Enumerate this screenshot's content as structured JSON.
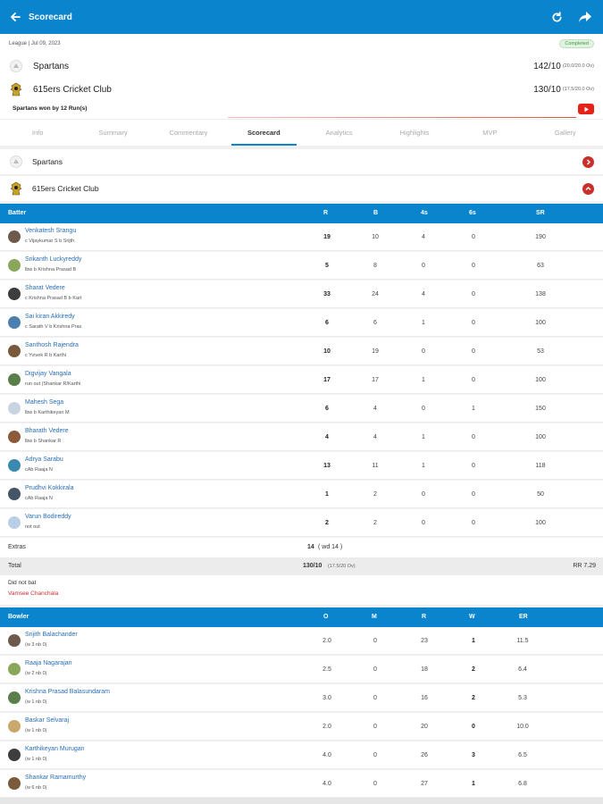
{
  "appbar": {
    "title": "Scorecard"
  },
  "match": {
    "meta": "League | Jul 09, 2023",
    "status": "Completed",
    "team1": {
      "name": "Spartans",
      "score": "142/10",
      "overs": "(20.0/20.0 Ov)"
    },
    "team2": {
      "name": "615ers Cricket Club",
      "score": "130/10",
      "overs": "(17.5/20.0 Ov)"
    },
    "result": "Spartans won by 12 Run(s)"
  },
  "tabs": [
    "Info",
    "Summary",
    "Commentary",
    "Scorecard",
    "Analytics",
    "Highlights",
    "MVP",
    "Gallery"
  ],
  "innings_tiles": [
    {
      "name": "Spartans"
    },
    {
      "name": "615ers Cricket Club"
    }
  ],
  "batting": {
    "headers": {
      "player": "Batter",
      "r": "R",
      "b": "B",
      "fours": "4s",
      "sixes": "6s",
      "sr": "SR"
    },
    "rows": [
      {
        "name": "Venkatesh Srangu",
        "dismissal": "c Vijaykumar S b Srijth",
        "r": "19",
        "b": "10",
        "fours": "4",
        "sixes": "0",
        "sr": "190"
      },
      {
        "name": "Srikanth Luckyreddy",
        "dismissal": "lbw b Krishna Prasad B",
        "r": "5",
        "b": "8",
        "fours": "0",
        "sixes": "0",
        "sr": "63"
      },
      {
        "name": "Sharat Vedere",
        "dismissal": "c Krishna Prasad B b Kart",
        "r": "33",
        "b": "24",
        "fours": "4",
        "sixes": "0",
        "sr": "138"
      },
      {
        "name": "Sai kiran Akkiredy",
        "dismissal": "c Sarath V b Krishna Pras",
        "r": "6",
        "b": "6",
        "fours": "1",
        "sixes": "0",
        "sr": "100"
      },
      {
        "name": "Santhosh Rajendra",
        "dismissal": "c Yvivek R b Karthi",
        "r": "10",
        "b": "19",
        "fours": "0",
        "sixes": "0",
        "sr": "53"
      },
      {
        "name": "Digvijay Vangala",
        "dismissal": "run out (Shankar R/Karthi",
        "r": "17",
        "b": "17",
        "fours": "1",
        "sixes": "0",
        "sr": "100"
      },
      {
        "name": "Mahesh Sega",
        "dismissal": "lbw b Karthikeyan M",
        "r": "6",
        "b": "4",
        "fours": "0",
        "sixes": "1",
        "sr": "150"
      },
      {
        "name": "Bharath Vedere",
        "dismissal": "lbw b Shankar R",
        "r": "4",
        "b": "4",
        "fours": "1",
        "sixes": "0",
        "sr": "100"
      },
      {
        "name": "Adrya Sarabu",
        "dismissal": "cAb Raaja N",
        "r": "13",
        "b": "11",
        "fours": "1",
        "sixes": "0",
        "sr": "118"
      },
      {
        "name": "Prudhvi Kokkirala",
        "dismissal": "cAb Raaja N",
        "r": "1",
        "b": "2",
        "fours": "0",
        "sixes": "0",
        "sr": "50"
      },
      {
        "name": "Varun Bodireddy",
        "dismissal": "not out",
        "r": "2",
        "b": "2",
        "fours": "0",
        "sixes": "0",
        "sr": "100"
      }
    ],
    "extras_label": "Extras",
    "extras_value": "14",
    "extras_detail": "( wd 14 )",
    "total_label": "Total",
    "total_value": "130/10",
    "total_overs": "(17.5/20 Ov)",
    "run_rate": "RR 7.29",
    "dnb_label": "Did not bat",
    "dnb_players": "Vamsee Chanchala"
  },
  "bowling": {
    "headers": {
      "player": "Bowler",
      "o": "O",
      "m": "M",
      "r": "R",
      "w": "W",
      "er": "ER"
    },
    "rows": [
      {
        "name": "Srijith Balachander",
        "extras": "(w 3 nb 0)",
        "o": "2.0",
        "m": "0",
        "r": "23",
        "w": "1",
        "er": "11.5"
      },
      {
        "name": "Raaja Nagarajan",
        "extras": "(w 2 nb 0)",
        "o": "2.5",
        "m": "0",
        "r": "18",
        "w": "2",
        "er": "6.4"
      },
      {
        "name": "Krishna Prasad Balasundaram",
        "extras": "(w 1 nb 0)",
        "o": "3.0",
        "m": "0",
        "r": "16",
        "w": "2",
        "er": "5.3"
      },
      {
        "name": "Baskar Selvaraj",
        "extras": "(w 1 nb 0)",
        "o": "2.0",
        "m": "0",
        "r": "20",
        "w": "0",
        "er": "10.0"
      },
      {
        "name": "Karthikeyan Murugan",
        "extras": "(w 1 nb 0)",
        "o": "4.0",
        "m": "0",
        "r": "26",
        "w": "3",
        "er": "6.5"
      },
      {
        "name": "Shankar Ramamurthy",
        "extras": "(w 6 nb 0)",
        "o": "4.0",
        "m": "0",
        "r": "27",
        "w": "1",
        "er": "6.8"
      }
    ]
  },
  "colors": {
    "primary": "#0a84cd",
    "danger": "#c9302c",
    "link": "#2a6fb5",
    "youtube": "#e62117"
  },
  "icons": [
    "back-arrow-icon",
    "refresh-icon",
    "share-icon",
    "youtube-icon",
    "chevron-right-icon",
    "chevron-up-icon"
  ]
}
